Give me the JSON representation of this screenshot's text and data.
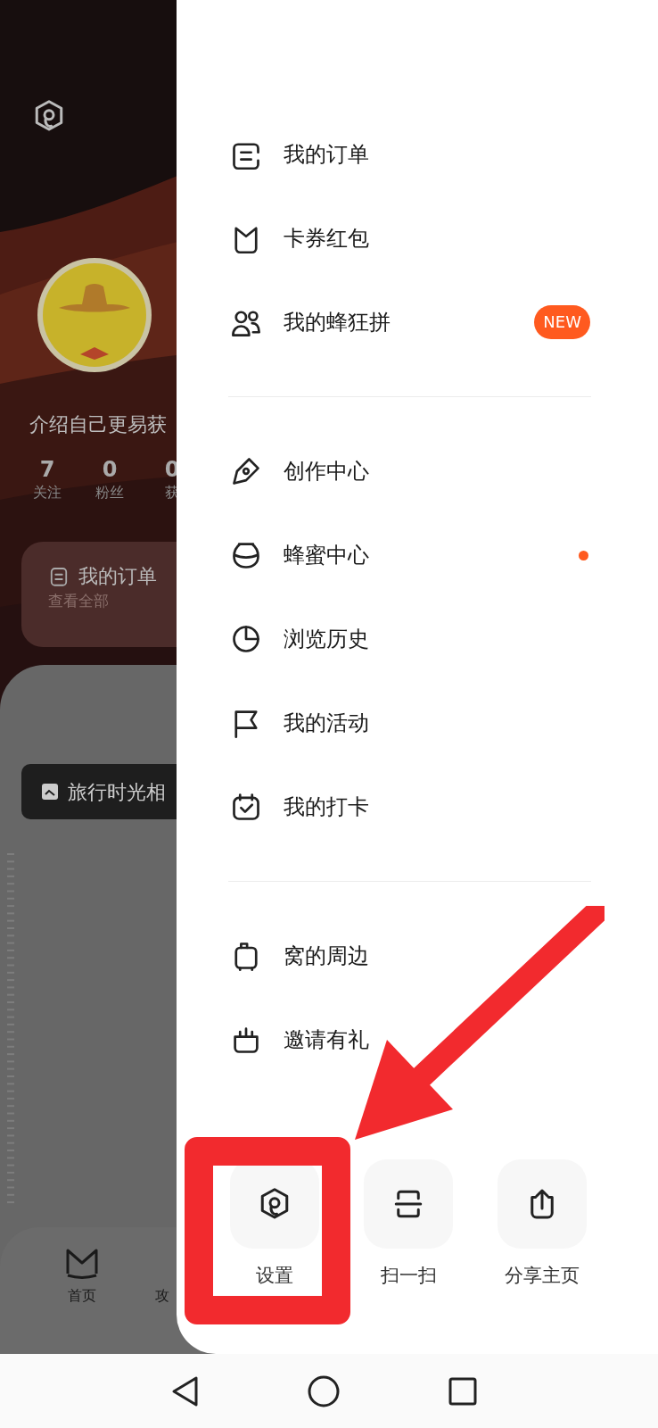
{
  "background_page": {
    "intro": "介绍自己更易获",
    "stats": [
      {
        "value": "7",
        "label": "关注"
      },
      {
        "value": "0",
        "label": "粉丝"
      },
      {
        "value": "0",
        "label": "获"
      }
    ],
    "order_card": {
      "title": "我的订单",
      "subtitle": "查看全部"
    },
    "album_chip": "旅行时光相",
    "tab_bar": [
      {
        "label": "首页"
      },
      {
        "label": "攻"
      }
    ]
  },
  "drawer": {
    "sections": [
      [
        {
          "label": "我的订单",
          "dot": false
        },
        {
          "label": "卡券红包",
          "dot": false
        },
        {
          "label": "我的蜂狂拼",
          "badge": "NEW",
          "dot": false
        }
      ],
      [
        {
          "label": "创作中心",
          "dot": false
        },
        {
          "label": "蜂蜜中心",
          "dot": true
        },
        {
          "label": "浏览历史",
          "dot": false
        },
        {
          "label": "我的活动",
          "dot": false
        },
        {
          "label": "我的打卡",
          "dot": false
        }
      ],
      [
        {
          "label": "窝的周边",
          "dot": false
        },
        {
          "label": "邀请有礼",
          "dot": false
        }
      ]
    ],
    "shortcuts": [
      {
        "label": "设置",
        "annotated": true
      },
      {
        "label": "扫一扫",
        "annotated": false
      },
      {
        "label": "分享主页",
        "annotated": false
      }
    ]
  }
}
